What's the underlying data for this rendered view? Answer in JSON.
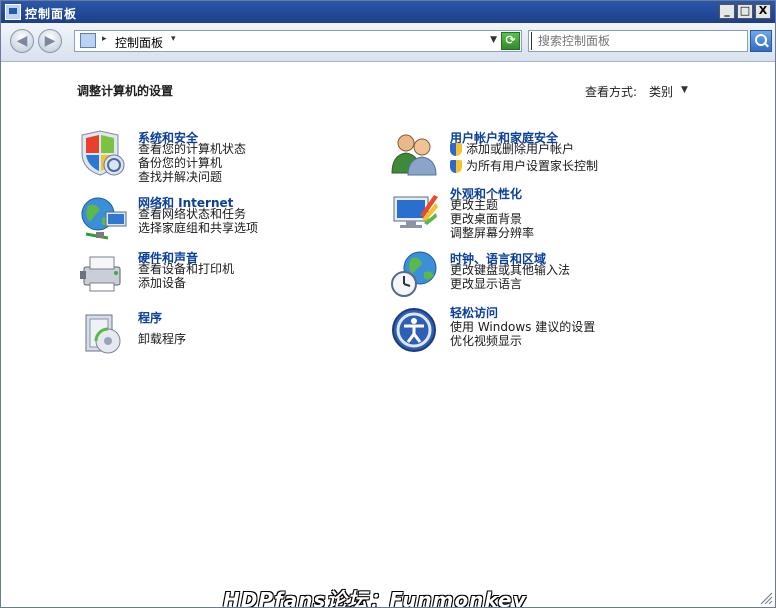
{
  "window": {
    "title": "控制面板",
    "buttons": {
      "minimize": "_",
      "maximize": "□",
      "close": "X"
    }
  },
  "toolbar": {
    "back": "◀",
    "forward": "▶",
    "breadcrumb": "控制面板",
    "refresh": "⟳",
    "search_placeholder": "搜索控制面板"
  },
  "main": {
    "heading": "调整计算机的设置",
    "view_by_label": "查看方式:",
    "view_by_value": "类别"
  },
  "categories": [
    {
      "icon": "system-security-icon",
      "title": "系统和安全",
      "links": [
        "查看您的计算机状态",
        "备份您的计算机",
        "查找并解决问题"
      ]
    },
    {
      "icon": "user-accounts-icon",
      "title": "用户帐户和家庭安全",
      "links": [
        "添加或删除用户帐户",
        "为所有用户设置家长控制"
      ]
    },
    {
      "icon": "network-internet-icon",
      "title": "网络和 Internet",
      "links": [
        "查看网络状态和任务",
        "选择家庭组和共享选项"
      ]
    },
    {
      "icon": "appearance-icon",
      "title": "外观和个性化",
      "links": [
        "更改主题",
        "更改桌面背景",
        "调整屏幕分辨率"
      ]
    },
    {
      "icon": "hardware-sound-icon",
      "title": "硬件和声音",
      "links": [
        "查看设备和打印机",
        "添加设备"
      ]
    },
    {
      "icon": "clock-language-region-icon",
      "title": "时钟、语言和区域",
      "links": [
        "更改键盘或其他输入法",
        "更改显示语言"
      ]
    },
    {
      "icon": "programs-icon",
      "title": "程序",
      "links": [
        "卸载程序"
      ]
    },
    {
      "icon": "ease-of-access-icon",
      "title": "轻松访问",
      "links": [
        "使用 Windows 建议的设置",
        "优化视频显示"
      ]
    }
  ],
  "watermark": "HDPfans论坛：Funmonkey",
  "colors": {
    "titlebar": "#1c3f8a",
    "link_title": "#0b3f99"
  }
}
